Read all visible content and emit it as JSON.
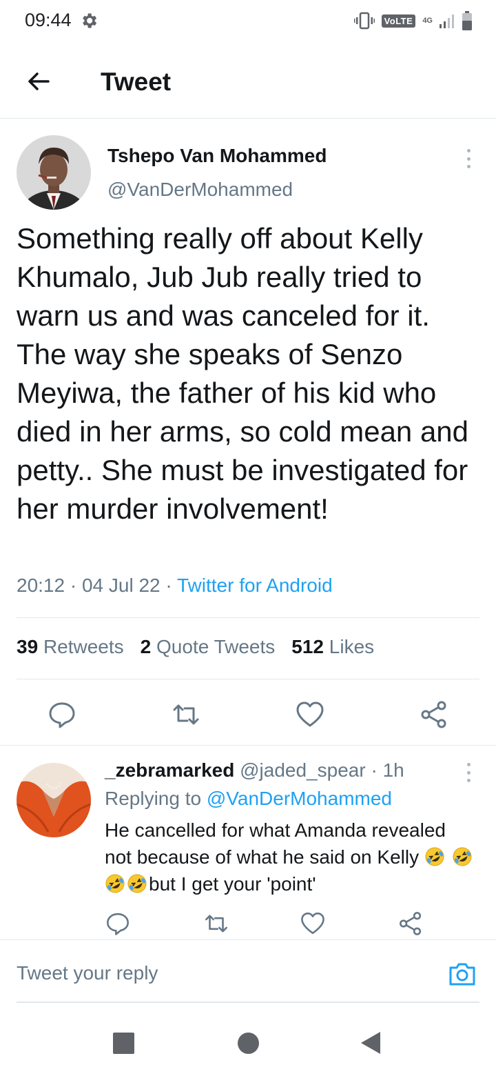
{
  "status_bar": {
    "time": "09:44",
    "volte": "VoLTE",
    "network": "4G",
    "icons": [
      "gear-icon",
      "vibrate-icon",
      "signal-icon",
      "battery-icon"
    ]
  },
  "header": {
    "title": "Tweet"
  },
  "tweet": {
    "author_name": "Tshepo Van Mohammed",
    "author_handle": "@VanDerMohammed",
    "text": "Something really off about Kelly Khumalo, Jub Jub really tried to warn us and was canceled for it. The way she speaks of Senzo Meyiwa, the father of his kid who died in her arms, so cold mean and petty.. She must be investigated for her murder involvement!",
    "time": "20:12",
    "date": "04 Jul 22",
    "separator": "·",
    "source": "Twitter for Android",
    "stats": {
      "retweets_count": "39",
      "retweets_label": "Retweets",
      "quotes_count": "2",
      "quotes_label": "Quote Tweets",
      "likes_count": "512",
      "likes_label": "Likes"
    }
  },
  "reply": {
    "author_name": "_zebramarked",
    "author_handle": "@jaded_spear",
    "separator": "·",
    "age": "1h",
    "replying_prefix": "Replying to",
    "replying_to": "@VanDerMohammed",
    "text_part1": "He cancelled for what Amanda revealed not because of what he said on Kelly",
    "text_part2": "but I get your 'point'",
    "emoji": "rolling-on-floor-laughing"
  },
  "compose": {
    "placeholder": "Tweet your reply"
  },
  "colors": {
    "accent": "#1da1f2",
    "text_primary": "#14171a",
    "text_secondary": "#657786",
    "divider": "#e1e8ed"
  }
}
